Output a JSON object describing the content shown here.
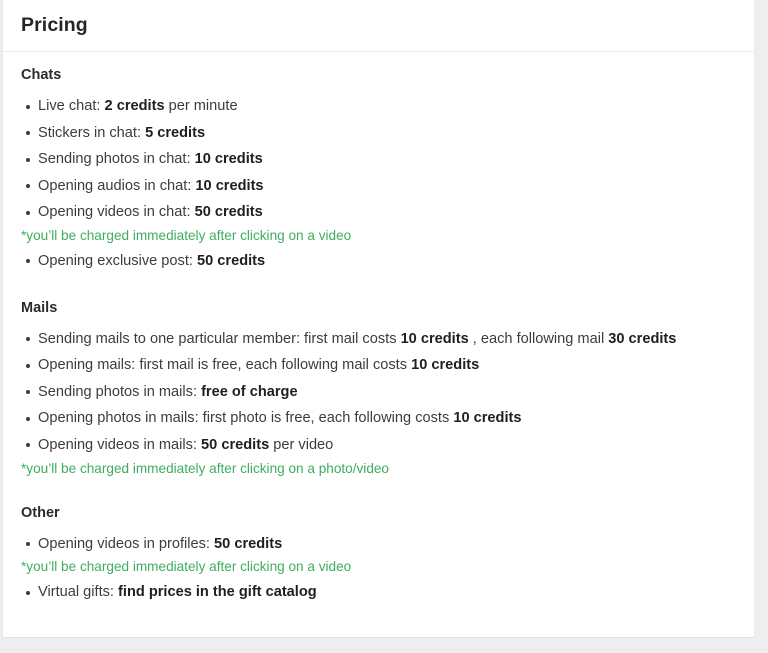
{
  "card": {
    "title": "Pricing"
  },
  "sections": [
    {
      "heading": "Chats",
      "blocks": [
        {
          "kind": "list",
          "items": [
            {
              "text": "Live chat: ",
              "bold": "2 credits",
              "tail": " per minute"
            },
            {
              "text": "Stickers in chat: ",
              "bold": "5 credits",
              "tail": ""
            },
            {
              "text": "Sending photos in chat: ",
              "bold": "10 credits",
              "tail": ""
            },
            {
              "text": "Opening audios in chat: ",
              "bold": "10 credits",
              "tail": ""
            },
            {
              "text": "Opening videos in chat: ",
              "bold": "50 credits",
              "tail": ""
            }
          ]
        },
        {
          "kind": "note",
          "text": "*you’ll be charged immediately after clicking on a video"
        },
        {
          "kind": "list",
          "items": [
            {
              "text": "Opening exclusive post: ",
              "bold": "50 credits",
              "tail": ""
            }
          ]
        }
      ]
    },
    {
      "heading": "Mails",
      "blocks": [
        {
          "kind": "list",
          "items": [
            {
              "text": "Sending mails to one particular member: first mail costs ",
              "bold": "10 credits",
              "tail": " , each following mail ",
              "bold2": "30 credits"
            },
            {
              "text": "Opening mails: first mail is free, each following mail costs ",
              "bold": "10 credits",
              "tail": ""
            },
            {
              "text": "Sending photos in mails: ",
              "bold": "free of charge",
              "tail": ""
            },
            {
              "text": "Opening photos in mails: first photo is free, each following costs ",
              "bold": "10 credits",
              "tail": ""
            },
            {
              "text": "Opening videos in mails: ",
              "bold": "50 credits",
              "tail": " per video"
            }
          ]
        },
        {
          "kind": "note",
          "text": "*you’ll be charged immediately after clicking on a photo/video"
        }
      ]
    },
    {
      "heading": "Other",
      "blocks": [
        {
          "kind": "list",
          "items": [
            {
              "text": "Opening videos in profiles: ",
              "bold": "50 credits",
              "tail": ""
            }
          ]
        },
        {
          "kind": "note",
          "text": "*you’ll be charged immediately after clicking on a video"
        },
        {
          "kind": "list",
          "items": [
            {
              "text": "Virtual gifts: ",
              "bold": "find prices in the gift catalog",
              "tail": ""
            }
          ]
        }
      ]
    }
  ],
  "colors": {
    "note_green": "#3eae5e",
    "text": "#3c3c3c",
    "bold_text": "#1f1f1f",
    "page_background": "#eeeeee",
    "card_background": "#ffffff"
  }
}
